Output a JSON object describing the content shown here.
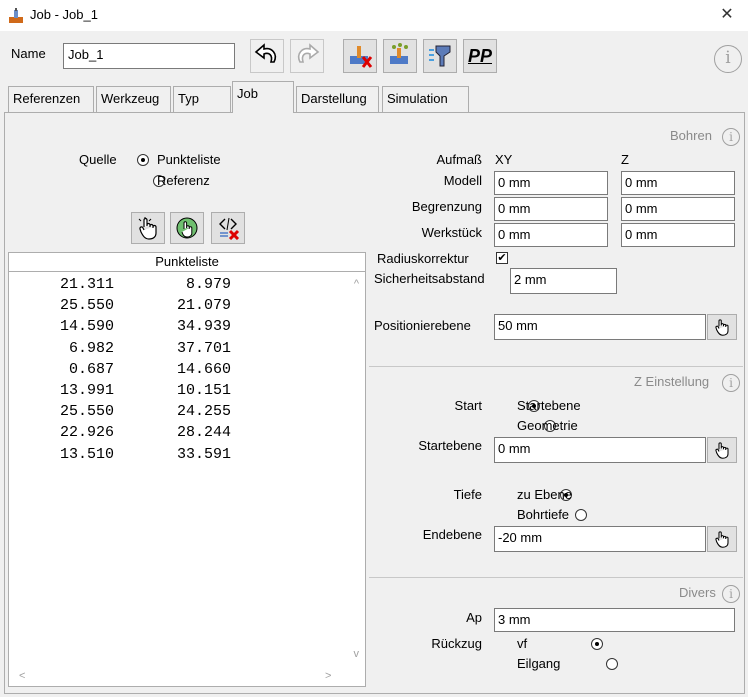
{
  "window": {
    "title": "Job - Job_1",
    "close_glyph": "✕"
  },
  "name_row": {
    "label": "Name",
    "value": "Job_1",
    "info_glyph": "i"
  },
  "toolbar": {
    "undo_icon": "undo-icon",
    "redo_icon": "redo-icon",
    "pp_label": "PP"
  },
  "tabs": [
    {
      "label": "Referenzen"
    },
    {
      "label": "Werkzeug"
    },
    {
      "label": "Typ"
    },
    {
      "label": "Job"
    },
    {
      "label": "Darstellung"
    },
    {
      "label": "Simulation"
    }
  ],
  "active_tab": "Job",
  "quelle": {
    "label": "Quelle",
    "options": [
      {
        "label": "Punkteliste",
        "selected": true
      },
      {
        "label": "Referenz",
        "selected": false
      }
    ]
  },
  "pointlist": {
    "header": "Punkteliste",
    "rows": [
      {
        "x": "21.311",
        "y": "8.979"
      },
      {
        "x": "25.550",
        "y": "21.079"
      },
      {
        "x": "14.590",
        "y": "34.939"
      },
      {
        "x": "6.982",
        "y": "37.701"
      },
      {
        "x": "0.687",
        "y": "14.660"
      },
      {
        "x": "13.991",
        "y": "10.151"
      },
      {
        "x": "25.550",
        "y": "24.255"
      },
      {
        "x": "22.926",
        "y": "28.244"
      },
      {
        "x": "13.510",
        "y": "33.591"
      }
    ],
    "scroll_up": "^",
    "scroll_down": "v",
    "scroll_left": "<",
    "scroll_right": ">"
  },
  "bohren": {
    "title": "Bohren",
    "aufmass_label": "Aufmaß",
    "col_xy": "XY",
    "col_z": "Z",
    "modell": {
      "label": "Modell",
      "xy": "0 mm",
      "z": "0 mm"
    },
    "begrenzung": {
      "label": "Begrenzung",
      "xy": "0 mm",
      "z": "0 mm"
    },
    "werkstueck": {
      "label": "Werkstück",
      "xy": "0 mm",
      "z": "0 mm"
    },
    "radiuskorrektur": {
      "label": "Radiuskorrektur",
      "checked": true,
      "glyph": "✔"
    },
    "sicherheitsabstand": {
      "label": "Sicherheitsabstand",
      "value": "2 mm"
    },
    "positionierebene": {
      "label": "Positionierebene",
      "value": "50 mm"
    }
  },
  "z_einstellung": {
    "title": "Z Einstellung",
    "start_label": "Start",
    "start_options": [
      {
        "label": "Startebene",
        "selected": true
      },
      {
        "label": "Geometrie",
        "selected": false
      }
    ],
    "startebene": {
      "label": "Startebene",
      "value": "0 mm"
    },
    "tiefe_label": "Tiefe",
    "tiefe_options": [
      {
        "label": "zu Ebene",
        "selected": true
      },
      {
        "label": "Bohrtiefe",
        "selected": false
      }
    ],
    "endebene": {
      "label": "Endebene",
      "value": "-20 mm"
    }
  },
  "divers": {
    "title": "Divers",
    "ap": {
      "label": "Ap",
      "value": "3 mm"
    },
    "rueckzug_label": "Rückzug",
    "rueckzug_options": [
      {
        "label": "vf",
        "selected": true
      },
      {
        "label": "Eilgang",
        "selected": false
      }
    ]
  },
  "info_glyph": "i"
}
